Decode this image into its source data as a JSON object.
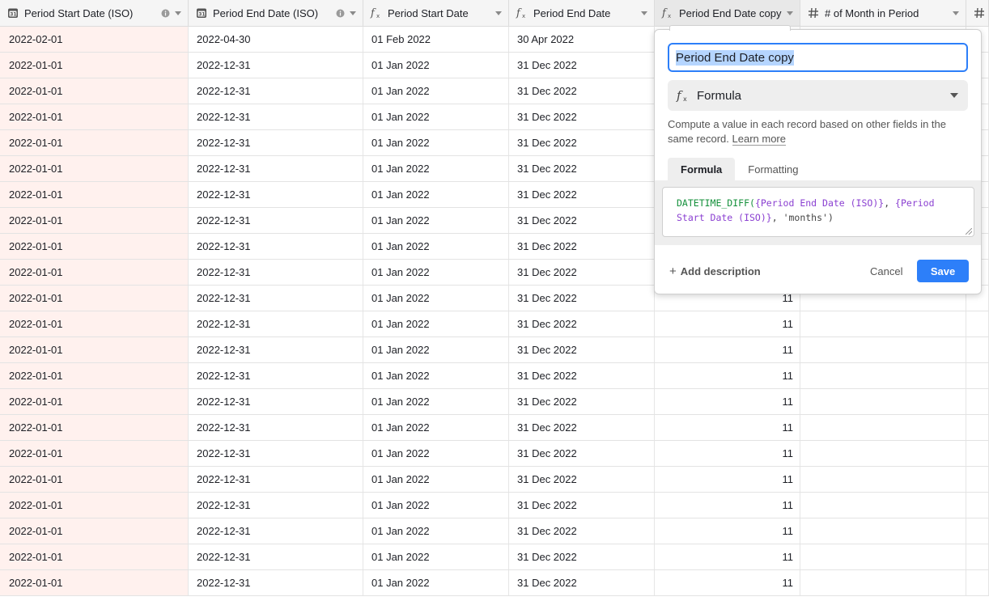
{
  "columns": [
    {
      "label": "Period Start Date (ISO)",
      "icon": "calendar-icon"
    },
    {
      "label": "Period End Date (ISO)",
      "icon": "calendar-icon"
    },
    {
      "label": "Period Start Date",
      "icon": "formula-icon"
    },
    {
      "label": "Period End Date",
      "icon": "formula-icon"
    },
    {
      "label": "Period End Date copy",
      "icon": "formula-icon"
    },
    {
      "label": "# of Month in Period",
      "icon": "number-icon"
    },
    {
      "label": "",
      "icon": "number-icon"
    }
  ],
  "rows": [
    [
      "2022-02-01",
      "2022-04-30",
      "01 Feb 2022",
      "30 Apr 2022",
      ""
    ],
    [
      "2022-01-01",
      "2022-12-31",
      "01 Jan 2022",
      "31 Dec 2022",
      ""
    ],
    [
      "2022-01-01",
      "2022-12-31",
      "01 Jan 2022",
      "31 Dec 2022",
      ""
    ],
    [
      "2022-01-01",
      "2022-12-31",
      "01 Jan 2022",
      "31 Dec 2022",
      ""
    ],
    [
      "2022-01-01",
      "2022-12-31",
      "01 Jan 2022",
      "31 Dec 2022",
      ""
    ],
    [
      "2022-01-01",
      "2022-12-31",
      "01 Jan 2022",
      "31 Dec 2022",
      ""
    ],
    [
      "2022-01-01",
      "2022-12-31",
      "01 Jan 2022",
      "31 Dec 2022",
      ""
    ],
    [
      "2022-01-01",
      "2022-12-31",
      "01 Jan 2022",
      "31 Dec 2022",
      ""
    ],
    [
      "2022-01-01",
      "2022-12-31",
      "01 Jan 2022",
      "31 Dec 2022",
      ""
    ],
    [
      "2022-01-01",
      "2022-12-31",
      "01 Jan 2022",
      "31 Dec 2022",
      ""
    ],
    [
      "2022-01-01",
      "2022-12-31",
      "01 Jan 2022",
      "31 Dec 2022",
      "11"
    ],
    [
      "2022-01-01",
      "2022-12-31",
      "01 Jan 2022",
      "31 Dec 2022",
      "11"
    ],
    [
      "2022-01-01",
      "2022-12-31",
      "01 Jan 2022",
      "31 Dec 2022",
      "11"
    ],
    [
      "2022-01-01",
      "2022-12-31",
      "01 Jan 2022",
      "31 Dec 2022",
      "11"
    ],
    [
      "2022-01-01",
      "2022-12-31",
      "01 Jan 2022",
      "31 Dec 2022",
      "11"
    ],
    [
      "2022-01-01",
      "2022-12-31",
      "01 Jan 2022",
      "31 Dec 2022",
      "11"
    ],
    [
      "2022-01-01",
      "2022-12-31",
      "01 Jan 2022",
      "31 Dec 2022",
      "11"
    ],
    [
      "2022-01-01",
      "2022-12-31",
      "01 Jan 2022",
      "31 Dec 2022",
      "11"
    ],
    [
      "2022-01-01",
      "2022-12-31",
      "01 Jan 2022",
      "31 Dec 2022",
      "11"
    ],
    [
      "2022-01-01",
      "2022-12-31",
      "01 Jan 2022",
      "31 Dec 2022",
      "11"
    ],
    [
      "2022-01-01",
      "2022-12-31",
      "01 Jan 2022",
      "31 Dec 2022",
      "11"
    ],
    [
      "2022-01-01",
      "2022-12-31",
      "01 Jan 2022",
      "31 Dec 2022",
      "11"
    ]
  ],
  "field_editor": {
    "name_value": "Period End Date copy",
    "type_label": "Formula",
    "type_icon": "formula-icon",
    "description": "Compute a value in each record based on other fields in the same record.",
    "learn_more": "Learn more",
    "tabs": [
      "Formula",
      "Formatting"
    ],
    "active_tab": "Formula",
    "formula": {
      "fn": "DATETIME_DIFF(",
      "field1": "{Period End Date (ISO)}",
      "sep1": ", ",
      "field2": "{Period Start Date (ISO)}",
      "sep2": ", ",
      "unit": "'months'",
      "close": ")"
    },
    "add_description": "Add description",
    "cancel": "Cancel",
    "save": "Save"
  },
  "colors": {
    "accent": "#2d7ff9",
    "primary_column_bg": "#fff1ee",
    "header_bg": "#f5f5f5",
    "formula_function": "#14903b",
    "formula_field": "#8a3fd1"
  }
}
